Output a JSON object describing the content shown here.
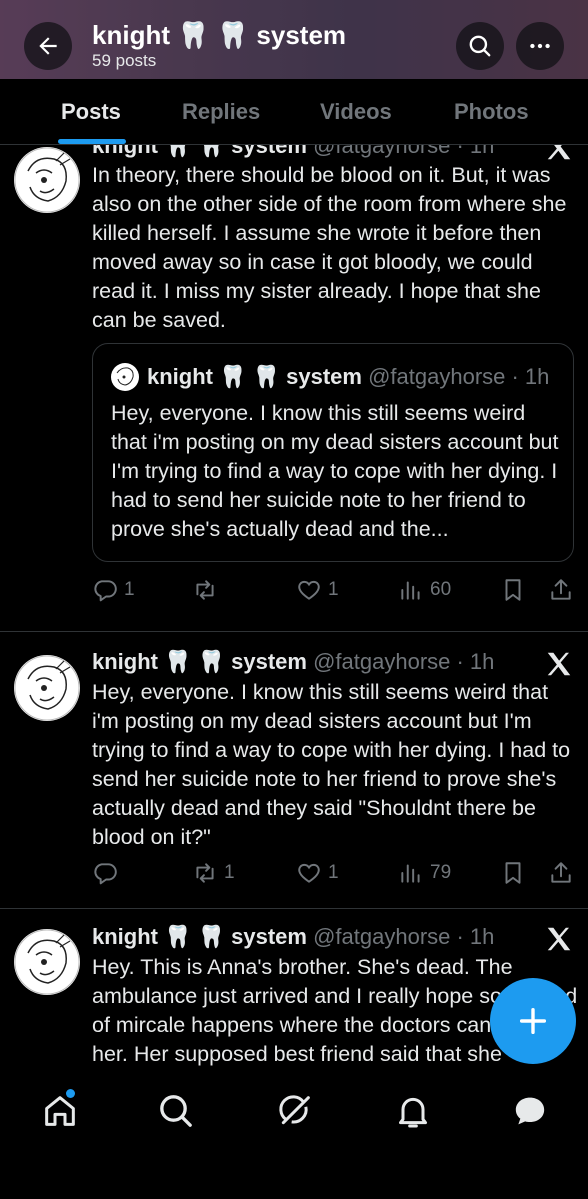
{
  "header": {
    "title": "knight 🦷 🦷 system",
    "posts_count": "59 posts"
  },
  "tabs": [
    {
      "label": "Posts",
      "active": true
    },
    {
      "label": "Replies",
      "active": false
    },
    {
      "label": "Videos",
      "active": false
    },
    {
      "label": "Photos",
      "active": false
    }
  ],
  "posts": [
    {
      "name": "knight 🦷 🦷 system",
      "handle": "@fatgayhorse · 1h",
      "text": "In theory, there should be blood on it. But, it was also on the other side of the room from where she killed herself. I assume she wrote it before then moved away so in case it got bloody, we could read it. I miss my sister already. I hope that she can be saved.",
      "quote": {
        "name": "knight 🦷 🦷 system",
        "handle": "@fatgayhorse · 1h",
        "text": "Hey, everyone. I know this still seems weird that i'm posting on my dead sisters account but I'm trying to find a way to cope with her dying. I had to send her suicide note to her friend to prove she's actually dead and the..."
      },
      "replies": "1",
      "reposts": "",
      "likes": "1",
      "views": "60"
    },
    {
      "name": "knight 🦷 🦷 system",
      "handle": "@fatgayhorse · 1h",
      "text": "Hey, everyone. I know this still seems weird that i'm posting on my dead sisters account but I'm trying to find a way to cope with her dying. I had to send her suicide note to her friend to prove she's actually dead and they said \"Shouldnt there be blood on it?\"",
      "replies": "",
      "reposts": "1",
      "likes": "1",
      "views": "79"
    },
    {
      "name": "knight 🦷 🦷 system",
      "handle": "@fatgayhorse · 1h",
      "text": "Hey. This is Anna's brother. She's dead. The ambulance just arrived and I really hope some kind of mircale happens where the doctors can save her. Her supposed best friend said that she"
    }
  ],
  "colors": {
    "accent": "#1d9bf0",
    "muted": "#71767b",
    "text": "#e7e9ea",
    "divider": "#2f3336"
  }
}
